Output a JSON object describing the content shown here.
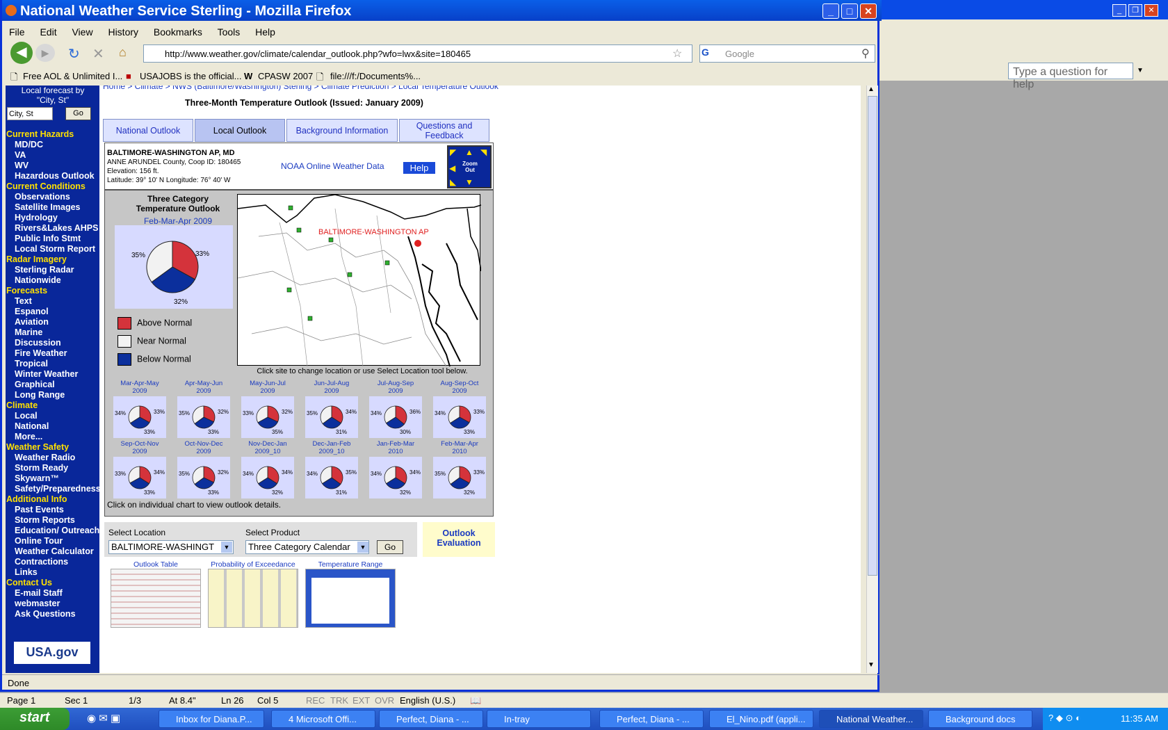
{
  "word": {
    "help_placeholder": "Type a question for help",
    "status": {
      "page": "Page 1",
      "sec": "Sec 1",
      "pages": "1/3",
      "at": "At 8.4\"",
      "ln": "Ln 26",
      "col": "Col 5",
      "rec": "REC",
      "trk": "TRK",
      "ext": "EXT",
      "ovr": "OVR",
      "lang": "English (U.S.)"
    }
  },
  "firefox": {
    "title": "National Weather Service Sterling - Mozilla Firefox",
    "menu": [
      "File",
      "Edit",
      "View",
      "History",
      "Bookmarks",
      "Tools",
      "Help"
    ],
    "url": "http://www.weather.gov/climate/calendar_outlook.php?wfo=lwx&site=180465",
    "search_placeholder": "Google",
    "bookmarks": [
      "Free AOL & Unlimited I...",
      "USAJOBS is the official...",
      "CPASW 2007",
      "file:///f:/Documents%..."
    ],
    "status": "Done"
  },
  "page": {
    "local_forecast": "Local forecast by \"City, St\"",
    "city_placeholder": "City, St",
    "go": "Go",
    "nav": [
      {
        "type": "hd",
        "label": "Current Hazards"
      },
      {
        "type": "it",
        "label": "MD/DC"
      },
      {
        "type": "it",
        "label": "VA"
      },
      {
        "type": "it",
        "label": "WV"
      },
      {
        "type": "it",
        "label": "Hazardous Outlook"
      },
      {
        "type": "hd",
        "label": "Current Conditions"
      },
      {
        "type": "it",
        "label": "Observations"
      },
      {
        "type": "it",
        "label": "Satellite Images"
      },
      {
        "type": "it",
        "label": "Hydrology"
      },
      {
        "type": "it",
        "label": "Rivers&Lakes AHPS"
      },
      {
        "type": "it",
        "label": "Public Info Stmt"
      },
      {
        "type": "it",
        "label": "Local Storm Report"
      },
      {
        "type": "hd",
        "label": "Radar Imagery"
      },
      {
        "type": "it",
        "label": "Sterling Radar"
      },
      {
        "type": "it",
        "label": "Nationwide"
      },
      {
        "type": "hd",
        "label": "Forecasts"
      },
      {
        "type": "it",
        "label": "Text"
      },
      {
        "type": "it",
        "label": "Espanol"
      },
      {
        "type": "it",
        "label": "Aviation"
      },
      {
        "type": "it",
        "label": "Marine"
      },
      {
        "type": "it",
        "label": "Discussion"
      },
      {
        "type": "it",
        "label": "Fire Weather"
      },
      {
        "type": "it",
        "label": "Tropical"
      },
      {
        "type": "it",
        "label": "Winter Weather"
      },
      {
        "type": "it",
        "label": "Graphical"
      },
      {
        "type": "it",
        "label": "Long Range"
      },
      {
        "type": "hd",
        "label": "Climate"
      },
      {
        "type": "it",
        "label": "Local"
      },
      {
        "type": "it",
        "label": "National"
      },
      {
        "type": "it",
        "label": "More..."
      },
      {
        "type": "hd",
        "label": "Weather Safety"
      },
      {
        "type": "it",
        "label": "Weather Radio"
      },
      {
        "type": "it",
        "label": "Storm Ready"
      },
      {
        "type": "it",
        "label": "Skywarn™"
      },
      {
        "type": "it",
        "label": "Safety/Preparedness"
      },
      {
        "type": "hd",
        "label": "Additional Info"
      },
      {
        "type": "it",
        "label": "Past Events"
      },
      {
        "type": "it",
        "label": "Storm Reports"
      },
      {
        "type": "it",
        "label": "Education/ Outreach"
      },
      {
        "type": "it",
        "label": "Online Tour"
      },
      {
        "type": "it",
        "label": "Weather Calculator"
      },
      {
        "type": "it",
        "label": "Contractions"
      },
      {
        "type": "it",
        "label": "Links"
      },
      {
        "type": "hd",
        "label": "Contact Us"
      },
      {
        "type": "it",
        "label": "E-mail Staff"
      },
      {
        "type": "it",
        "label": "webmaster"
      },
      {
        "type": "it",
        "label": "Ask Questions"
      }
    ],
    "usagov": "USA.gov",
    "breadcrumb": "Home > Climate > NWS (Baltimore/Washington) Sterling > Climate Prediction > Local Temperature Outlook",
    "heading": "Three-Month Temperature Outlook (Issued: January 2009)",
    "tabs": [
      "National Outlook",
      "Local Outlook",
      "Background Information",
      "Questions and Feedback"
    ],
    "station": {
      "name": "BALTIMORE-WASHINGTON AP, MD",
      "county": "ANNE ARUNDEL County, Coop ID: 180465",
      "elev": "Elevation: 156 ft.",
      "latlon": "Latitude: 39° 10' N Longitude: 76° 40' W",
      "noaa": "NOAA Online Weather Data",
      "help": "Help",
      "zoom": "Zoom Out"
    },
    "pie_title_1": "Three Category",
    "pie_title_2": "Temperature Outlook",
    "pie_period": "Feb-Mar-Apr 2009",
    "main_pct": {
      "above": "33%",
      "near": "35%",
      "below": "32%"
    },
    "legend": [
      "Above Normal",
      "Near Normal",
      "Below Normal"
    ],
    "map_label": "BALTIMORE-WASHINGTON AP",
    "map_note": "Click site to change location or use Select Location tool below.",
    "minis": [
      {
        "p1": "Mar-Apr-May",
        "p2": "2009",
        "l": "34%",
        "r": "33%",
        "b": "33%",
        "a": 33,
        "n": 34,
        "w": 33
      },
      {
        "p1": "Apr-May-Jun",
        "p2": "2009",
        "l": "35%",
        "r": "32%",
        "b": "33%",
        "a": 32,
        "n": 35,
        "w": 33
      },
      {
        "p1": "May-Jun-Jul",
        "p2": "2009",
        "l": "33%",
        "r": "32%",
        "b": "35%",
        "a": 32,
        "n": 33,
        "w": 35
      },
      {
        "p1": "Jun-Jul-Aug",
        "p2": "2009",
        "l": "35%",
        "r": "34%",
        "b": "31%",
        "a": 34,
        "n": 35,
        "w": 31
      },
      {
        "p1": "Jul-Aug-Sep",
        "p2": "2009",
        "l": "34%",
        "r": "36%",
        "b": "30%",
        "a": 36,
        "n": 34,
        "w": 30
      },
      {
        "p1": "Aug-Sep-Oct",
        "p2": "2009",
        "l": "34%",
        "r": "33%",
        "b": "33%",
        "a": 33,
        "n": 34,
        "w": 33
      },
      {
        "p1": "Sep-Oct-Nov",
        "p2": "2009",
        "l": "33%",
        "r": "34%",
        "b": "33%",
        "a": 34,
        "n": 33,
        "w": 33
      },
      {
        "p1": "Oct-Nov-Dec",
        "p2": "2009",
        "l": "35%",
        "r": "32%",
        "b": "33%",
        "a": 32,
        "n": 35,
        "w": 33
      },
      {
        "p1": "Nov-Dec-Jan",
        "p2": "2009_10",
        "l": "34%",
        "r": "34%",
        "b": "32%",
        "a": 34,
        "n": 34,
        "w": 32
      },
      {
        "p1": "Dec-Jan-Feb",
        "p2": "2009_10",
        "l": "34%",
        "r": "35%",
        "b": "31%",
        "a": 35,
        "n": 34,
        "w": 31
      },
      {
        "p1": "Jan-Feb-Mar",
        "p2": "2010",
        "l": "34%",
        "r": "34%",
        "b": "32%",
        "a": 34,
        "n": 34,
        "w": 32
      },
      {
        "p1": "Feb-Mar-Apr",
        "p2": "2010",
        "l": "35%",
        "r": "33%",
        "b": "32%",
        "a": 33,
        "n": 35,
        "w": 32
      }
    ],
    "panel_foot": "Click on individual chart to view outlook details.",
    "select_location_label": "Select Location",
    "select_location_value": "BALTIMORE-WASHINGT",
    "select_product_label": "Select Product",
    "select_product_value": "Three Category Calendar",
    "go2": "Go",
    "outlook_eval": "Outlook Evaluation",
    "thumbs": [
      "Outlook Table",
      "Probability of Exceedance",
      "Temperature Range"
    ]
  },
  "taskbar": {
    "start": "start",
    "tasks": [
      "Inbox for Diana.P...",
      "4 Microsoft Offi...",
      "Perfect, Diana - ...",
      "In-tray",
      "Perfect, Diana - ...",
      "El_Nino.pdf (appli...",
      "National Weather...",
      "Background docs"
    ],
    "clock": "11:35 AM"
  },
  "colors": {
    "above": "#d4333b",
    "near": "#f2f2f2",
    "below": "#0b2f9c",
    "nav_bg": "#09279a",
    "nav_head": "#ffe000"
  }
}
